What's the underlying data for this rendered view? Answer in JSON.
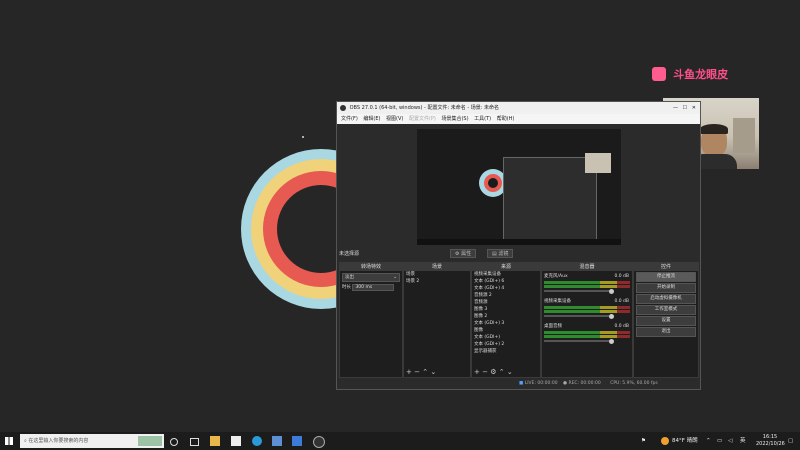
{
  "logo": {
    "text": "斗鱼龙眼皮"
  },
  "obs": {
    "title": "OBS 27.0.1 (64-bit, windows) - 配置文件: 未命名 - 场景: 未命名",
    "menu": [
      "文件(F)",
      "编辑(E)",
      "视图(V)",
      "配置文件(P)",
      "场景集合(S)",
      "工具(T)",
      "帮助(H)"
    ],
    "scene_transition_label": "未选择源",
    "toolbar": {
      "properties": "属性",
      "filters": "滤镜"
    },
    "docks": {
      "transitions": {
        "title": "转场特效",
        "type": "淡出",
        "duration_label": "时长",
        "duration": "300 ms"
      },
      "scenes": {
        "title": "场景",
        "items": [
          "场景",
          "场景 2"
        ]
      },
      "sources": {
        "title": "来源",
        "items": [
          "视频采集设备",
          "文本 (GDI+) 6",
          "文本 (GDI+) 4",
          "音频源 2",
          "音频源",
          "图像 3",
          "图像 2",
          "文本 (GDI+) 3",
          "图像",
          "文本 (GDI+)",
          "文本 (GDI+) 2",
          "显示器捕获"
        ]
      },
      "mixer": {
        "title": "混音器",
        "channels": [
          {
            "name": "麦克风/Aux",
            "db": "0.0 dB"
          },
          {
            "name": "视频采集设备",
            "db": "0.0 dB"
          },
          {
            "name": "桌面音频",
            "db": "0.0 dB"
          }
        ]
      },
      "controls": {
        "title": "控件",
        "buttons": [
          "停止推流",
          "开始录制",
          "启动虚拟摄像机",
          "工作室模式",
          "设置",
          "退出"
        ]
      }
    },
    "status": {
      "live_label": "LIVE:",
      "live_time": "00:00:00",
      "rec_label": "REC:",
      "rec_time": "00:00:00",
      "cpu": "CPU: 5.9%, 60.00 fps"
    }
  },
  "taskbar": {
    "search_placeholder": "在这里输入你要搜索的内容",
    "weather": "84°F 晴朗",
    "lang": "英",
    "time": "16:15",
    "date": "2022/10/26"
  }
}
